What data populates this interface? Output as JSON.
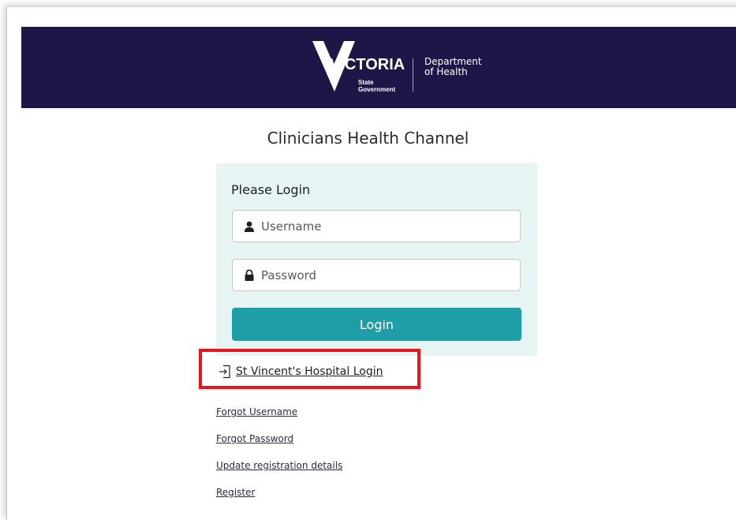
{
  "header": {
    "logo_word": "VICTORIA",
    "logo_sub_line1": "State",
    "logo_sub_line2": "Government",
    "dept_line1": "Department",
    "dept_line2": "of Health",
    "background_color": "#201547"
  },
  "page": {
    "title": "Clinicians Health Channel"
  },
  "login_form": {
    "heading": "Please Login",
    "username": {
      "placeholder": "Username",
      "value": "",
      "icon": "user-icon"
    },
    "password": {
      "placeholder": "Password",
      "value": "",
      "icon": "lock-icon"
    },
    "submit_label": "Login",
    "accent_color": "#1e9fa8",
    "panel_color": "#e6f4f4"
  },
  "sso_link": {
    "label": "St Vincent's Hospital Login",
    "icon": "sign-in-icon",
    "highlight_color": "#e8151b"
  },
  "links": [
    {
      "label": "Forgot Username"
    },
    {
      "label": "Forgot Password"
    },
    {
      "label": "Update registration details"
    },
    {
      "label": "Register"
    }
  ]
}
